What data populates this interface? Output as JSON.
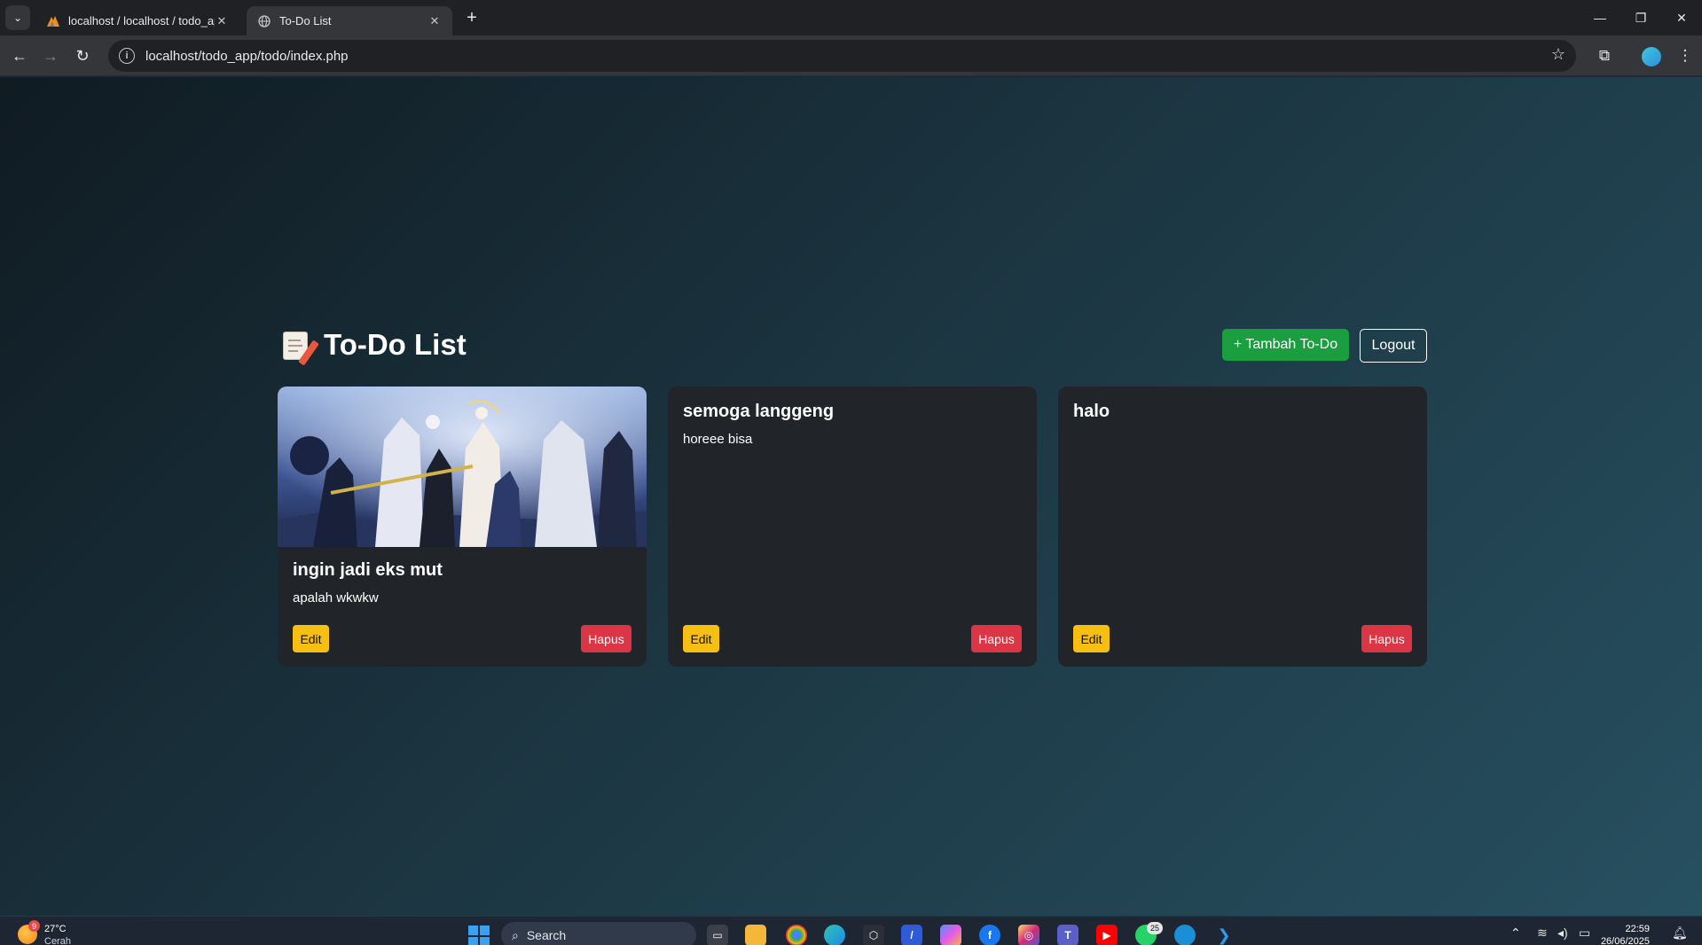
{
  "browser": {
    "tabs": [
      {
        "title": "localhost / localhost / todo_app",
        "icon": "phpmyadmin-icon"
      },
      {
        "title": "To-Do List",
        "icon": "globe-icon"
      }
    ],
    "url": "localhost/todo_app/todo/index.php"
  },
  "page": {
    "title": "To-Do List",
    "title_icon": "memo-icon",
    "add_button": "+ Tambah To-Do",
    "logout_button": "Logout",
    "colors": {
      "add": "#1a9e3f",
      "edit": "#f6bf11",
      "hapus": "#dc3545",
      "card": "#212529"
    }
  },
  "todos": [
    {
      "title": "ingin jadi eks mut",
      "description": "apalah wkwkw",
      "has_image": true,
      "edit": "Edit",
      "delete": "Hapus"
    },
    {
      "title": "semoga langgeng",
      "description": "horeee bisa",
      "has_image": false,
      "edit": "Edit",
      "delete": "Hapus"
    },
    {
      "title": "halo",
      "description": "",
      "has_image": false,
      "edit": "Edit",
      "delete": "Hapus"
    }
  ],
  "taskbar": {
    "weather": {
      "temp": "27°C",
      "condition": "Cerah",
      "badge": "9"
    },
    "search_label": "Search",
    "whatsapp_badge": "25",
    "time": "22:59",
    "date": "26/06/2025"
  }
}
